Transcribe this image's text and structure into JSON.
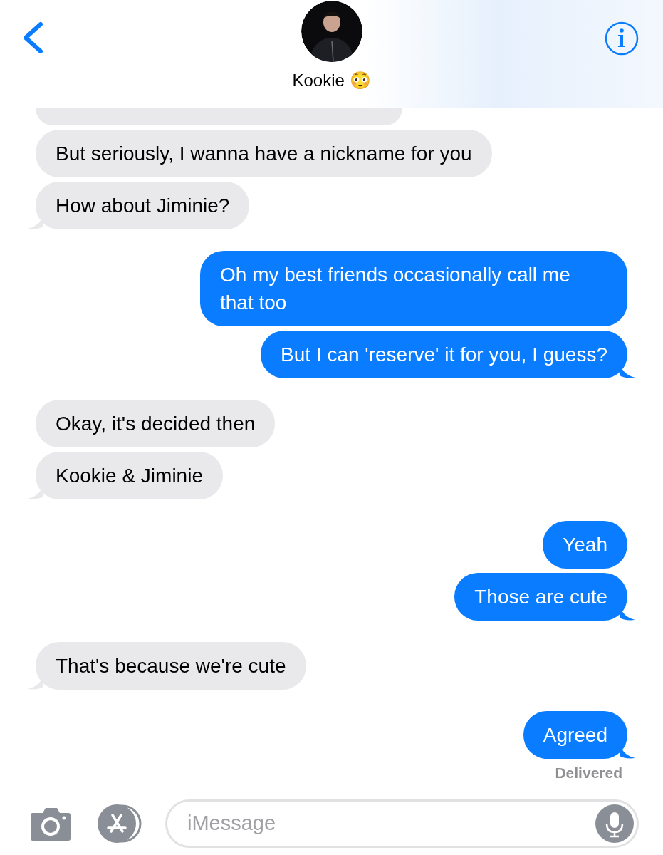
{
  "header": {
    "contact_name": "Kookie 😳"
  },
  "messages": [
    {
      "kind": "incoming_partial",
      "tail": false
    },
    {
      "kind": "incoming",
      "text": "But seriously, I wanna have a nickname for you",
      "tail": false
    },
    {
      "kind": "incoming",
      "text": "How about Jiminie?",
      "tail": true
    },
    {
      "kind": "outgoing",
      "text": "Oh my best friends occasionally call me that too",
      "tail": false
    },
    {
      "kind": "outgoing",
      "text": "But I can 'reserve' it for you, I guess?",
      "tail": true
    },
    {
      "kind": "incoming",
      "text": "Okay, it's decided then",
      "tail": false
    },
    {
      "kind": "incoming",
      "text": "Kookie & Jiminie",
      "tail": true
    },
    {
      "kind": "outgoing",
      "text": "Yeah",
      "tail": false
    },
    {
      "kind": "outgoing",
      "text": "Those are cute",
      "tail": true
    },
    {
      "kind": "incoming",
      "text": "That's because we're cute",
      "tail": true
    },
    {
      "kind": "outgoing",
      "text": "Agreed",
      "tail": true
    }
  ],
  "status": "Delivered",
  "composer": {
    "placeholder": "iMessage"
  }
}
